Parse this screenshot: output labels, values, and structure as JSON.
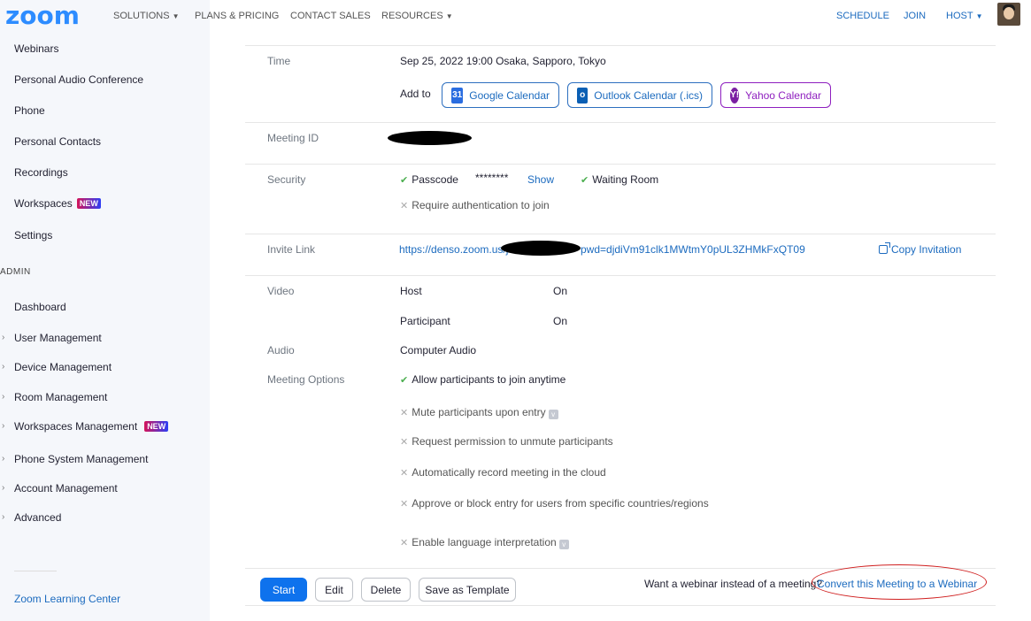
{
  "nav": {
    "logo": "zoom",
    "solutions": "SOLUTIONS",
    "plans": "PLANS & PRICING",
    "contact": "CONTACT SALES",
    "resources": "RESOURCES",
    "schedule": "SCHEDULE",
    "join": "JOIN",
    "host": "HOST"
  },
  "sidebar": {
    "items_top": [
      "Webinars",
      "Personal Audio Conference",
      "Phone",
      "Personal Contacts",
      "Recordings",
      "Workspaces",
      "Settings"
    ],
    "new_badge": "NEW",
    "admin_heading": "ADMIN",
    "items_admin": [
      "Dashboard",
      "User Management",
      "Device Management",
      "Room Management",
      "Workspaces Management",
      "Phone System Management",
      "Account Management",
      "Advanced"
    ],
    "learning_center": "Zoom Learning Center"
  },
  "meeting": {
    "time_label": "Time",
    "time_value": "Sep 25, 2022 19:00 Osaka, Sapporo, Tokyo",
    "add_to": "Add to",
    "google_cal": "Google Calendar",
    "google_cal_icon": "31",
    "outlook_cal": "Outlook Calendar (.ics)",
    "outlook_cal_icon": "o",
    "yahoo_cal": "Yahoo Calendar",
    "yahoo_cal_icon": "Y!",
    "meeting_id_label": "Meeting ID",
    "security_label": "Security",
    "passcode": "Passcode",
    "passcode_value": "********",
    "show": "Show",
    "waiting_room": "Waiting Room",
    "require_auth": "Require authentication to join",
    "invite_label": "Invite Link",
    "invite_prefix": "https://denso.zoom.us/j",
    "invite_suffix": "pwd=djdiVm91clk1MWtmY0pUL3ZHMkFxQT09",
    "copy_invitation": "Copy Invitation",
    "video_label": "Video",
    "host": "Host",
    "host_value": "On",
    "participant": "Participant",
    "participant_value": "On",
    "audio_label": "Audio",
    "audio_value": "Computer Audio",
    "options_label": "Meeting Options",
    "opt_join_anytime": "Allow participants to join anytime",
    "opt_mute": "Mute participants upon entry",
    "opt_unmute": "Request permission to unmute participants",
    "opt_record": "Automatically record meeting in the cloud",
    "opt_approve": "Approve or block entry for users from specific countries/regions",
    "opt_language": "Enable language interpretation"
  },
  "actions": {
    "start": "Start",
    "edit": "Edit",
    "delete": "Delete",
    "save_template": "Save as Template",
    "webinar_prompt": "Want a webinar instead of a meeting?",
    "convert": "Convert this Meeting to a Webinar"
  },
  "colors": {
    "brand": "#2d8cff",
    "link": "#1c6bbf",
    "primary_button": "#0e72ed",
    "annotation": "#d02020"
  }
}
